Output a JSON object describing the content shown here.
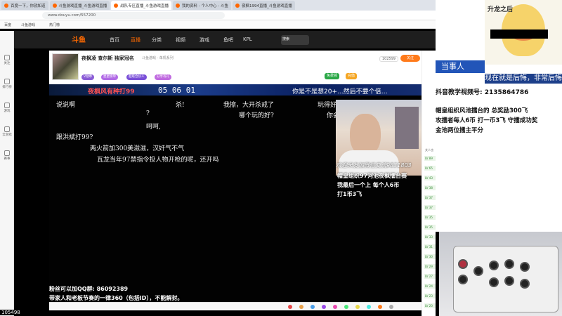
{
  "browser": {
    "tabs": [
      "百度一下，你就知道",
      "斗鱼游戏直播_斗鱼游戏直播",
      "战队专区直播_斗鱼游戏直播",
      "我的资料 - 个人中心 - 斗鱼",
      "夜枫1994直播_斗鱼游戏直播"
    ],
    "url": "www.douyu.com/557200",
    "bookmarks": [
      "百度",
      "斗鱼游戏",
      "热门榜"
    ]
  },
  "douyu": {
    "logo": "斗鱼",
    "nav": [
      "首页",
      "直播",
      "分类",
      "视频",
      "游戏",
      "鱼吧",
      "KPL"
    ],
    "search_label": "搜索"
  },
  "sidebar": [
    {
      "icon": "heart-icon",
      "label": "关注"
    },
    {
      "icon": "list-icon",
      "label": "排行榜"
    },
    {
      "icon": "game-icon",
      "label": "游戏"
    },
    {
      "icon": "gamepad-icon",
      "label": "云游戏"
    },
    {
      "icon": "shield-icon",
      "label": "赛事"
    }
  ],
  "room": {
    "title": "夜枫凌 查尔斯 独家冠名",
    "category": "斗鱼游戏 · 单机系列",
    "hot": "102599",
    "follow": "关注",
    "level_tag": "V勋章",
    "tags": [
      "星星榜单",
      "超级合伙人",
      "分享有礼"
    ],
    "buttons": [
      "免费领",
      "充值"
    ]
  },
  "video": {
    "banner_left": "夜枫风有种打99",
    "banner_nums": "05   06   01",
    "banner_right": "你是不是想20+...然后不要个倍…",
    "danmaku": [
      "说说啊",
      "杀!",
      "我擦，大开杀戒了",
      "玩得好",
      "哪个玩的好?",
      "?",
      "呵呵,",
      "你会赢了",
      "跟洪斌打99?",
      "两火箭加300美滋滋，汉奸气不气",
      "瓦龙当年97禁指令投人物开枪的呢，还开吗"
    ],
    "cam_caption_1": "欢迎米友加微信交流9831803",
    "cam_caption_2": "帽皇组织97河池夜枫擂台赛",
    "cam_caption_3": "我最后一个上  每个人6币",
    "cam_caption_4": "打1币3飞",
    "bottom_1": "粉丝可以加QQ群: 86092389",
    "bottom_2": "带家人和老板节奏的一律360（包括ID），不能解封。"
  },
  "overlay": {
    "duck_caption": "升龙之后",
    "dangshi": "当事人",
    "phrase": "现在就是后悔，非常后悔",
    "douyin": "抖音教学视频号: 2135864786",
    "line1": "帽皇组织风池擂台的  总奖励300飞",
    "line2": "攻擂者每人6币    打一币3飞    守擂成功奖",
    "line3": "金池两位擂主平分"
  },
  "chat_strip": {
    "first_label": "关人也开局",
    "items": [
      "LV 89",
      "LV 65",
      "LV 43",
      "LV 38",
      "LV 37",
      "LV 37",
      "LV 35",
      "LV 35",
      "LV 33",
      "LV 31",
      "LV 30",
      "LV 29",
      "LV 27",
      "LV 24",
      "LV 23",
      "LV 20"
    ]
  },
  "footer_count": "105498"
}
